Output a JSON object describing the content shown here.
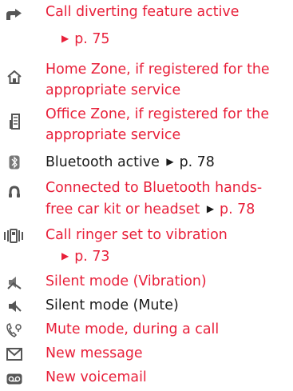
{
  "colors": {
    "accent": "#e8203a",
    "text": "#1a1a1a",
    "icon": "#555555"
  },
  "items": [
    {
      "icon": "call-divert-icon",
      "line1": "Call diverting feature active",
      "ref": "p. 75",
      "color": "red"
    },
    {
      "icon": "home-zone-icon",
      "line1": "Home Zone, if registered for the",
      "line2": "appropriate service",
      "color": "red"
    },
    {
      "icon": "office-zone-icon",
      "line1": "Office Zone, if registered for the",
      "line2": "appropriate service",
      "color": "red"
    },
    {
      "icon": "bluetooth-icon",
      "line1": "Bluetooth active",
      "ref": "p. 78",
      "color": "black"
    },
    {
      "icon": "headset-icon",
      "line1": "Connected to Bluetooth hands-",
      "line2": "free car kit or headset",
      "ref": "p. 78",
      "color": "red"
    },
    {
      "icon": "vibration-icon",
      "line1": "Call ringer set to vibration",
      "ref": "p. 73",
      "color": "red"
    },
    {
      "icon": "silent-vibration-icon",
      "line1": "Silent mode (Vibration)",
      "color": "red"
    },
    {
      "icon": "silent-mute-icon",
      "line1": "Silent mode (Mute)",
      "color": "black"
    },
    {
      "icon": "mute-call-icon",
      "line1": "Mute mode, during a call",
      "color": "red"
    },
    {
      "icon": "envelope-icon",
      "line1": "New message",
      "color": "red"
    },
    {
      "icon": "voicemail-icon",
      "line1": "New voicemail",
      "color": "red"
    }
  ]
}
